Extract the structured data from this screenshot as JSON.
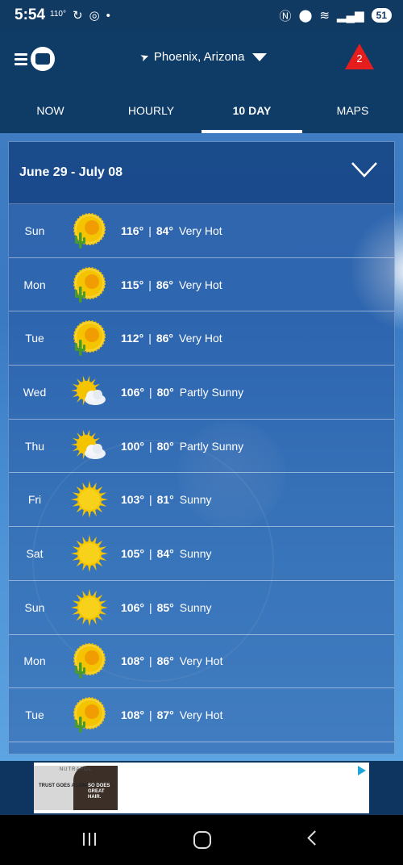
{
  "status_bar": {
    "time": "5:54",
    "temp": "110°",
    "battery": "51"
  },
  "header": {
    "location": "Phoenix, Arizona",
    "alert_count": "2"
  },
  "tabs": [
    {
      "label": "NOW",
      "active": false
    },
    {
      "label": "HOURLY",
      "active": false
    },
    {
      "label": "10 DAY",
      "active": true
    },
    {
      "label": "MAPS",
      "active": false
    }
  ],
  "forecast": {
    "date_range": "June 29 - July 08",
    "days": [
      {
        "day": "Sun",
        "high": "116°",
        "low": "84°",
        "condition": "Very Hot",
        "icon": "hot-sun-cactus-icon"
      },
      {
        "day": "Mon",
        "high": "115°",
        "low": "86°",
        "condition": "Very Hot",
        "icon": "hot-sun-cactus-icon"
      },
      {
        "day": "Tue",
        "high": "112°",
        "low": "86°",
        "condition": "Very Hot",
        "icon": "hot-sun-cactus-icon"
      },
      {
        "day": "Wed",
        "high": "106°",
        "low": "80°",
        "condition": "Partly Sunny",
        "icon": "partly-sunny-icon"
      },
      {
        "day": "Thu",
        "high": "100°",
        "low": "80°",
        "condition": "Partly Sunny",
        "icon": "partly-sunny-icon"
      },
      {
        "day": "Fri",
        "high": "103°",
        "low": "81°",
        "condition": "Sunny",
        "icon": "sunny-icon"
      },
      {
        "day": "Sat",
        "high": "105°",
        "low": "84°",
        "condition": "Sunny",
        "icon": "sunny-icon"
      },
      {
        "day": "Sun",
        "high": "106°",
        "low": "85°",
        "condition": "Sunny",
        "icon": "sunny-icon"
      },
      {
        "day": "Mon",
        "high": "108°",
        "low": "86°",
        "condition": "Very Hot",
        "icon": "hot-sun-cactus-icon"
      },
      {
        "day": "Tue",
        "high": "108°",
        "low": "87°",
        "condition": "Very Hot",
        "icon": "hot-sun-cactus-icon"
      }
    ]
  },
  "ad": {
    "brand": "NUTRAFOL",
    "text_left": "TRUST GOES A LONG WAY.",
    "text_right": "SO DOES GREAT HAIR."
  },
  "colors": {
    "header_bg": "#0f3c67",
    "alert_red": "#e51d1d",
    "sun_yellow": "#f5c400"
  }
}
